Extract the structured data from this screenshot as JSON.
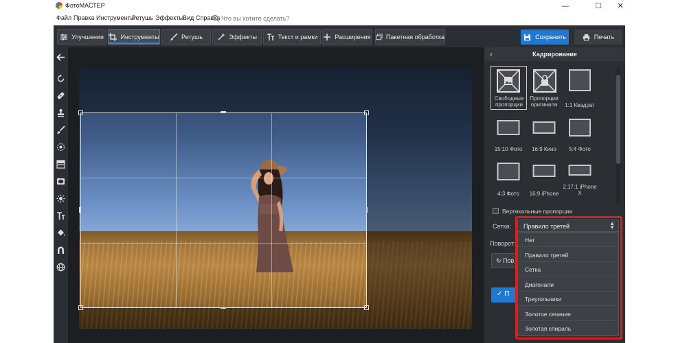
{
  "window": {
    "title": "ФотоМАСТЕР",
    "minimize": "—",
    "maximize": "☐",
    "close": "✕"
  },
  "menu": {
    "items": [
      "Файл",
      "Правка",
      "Инструменты",
      "Ретушь",
      "Эффекты",
      "Вид",
      "Справка"
    ],
    "search_placeholder": "Что вы хотите сделать?"
  },
  "toolbar": {
    "tabs": [
      {
        "label": "Улучшения",
        "icon": "sliders-icon"
      },
      {
        "label": "Инструменты",
        "icon": "crop-icon",
        "active": true
      },
      {
        "label": "Ретушь",
        "icon": "brush-icon"
      },
      {
        "label": "Эффекты",
        "icon": "magic-wand-icon"
      },
      {
        "label": "Текст и рамки",
        "icon": "text-icon"
      },
      {
        "label": "Расширения",
        "icon": "plus-icon"
      },
      {
        "label": "Пакетная обработка",
        "icon": "batch-icon"
      }
    ],
    "save_label": "Сохранить",
    "print_label": "Печать"
  },
  "left_tools": [
    "back-arrow-icon",
    "rotate-icon",
    "healing-patch-icon",
    "stamp-icon",
    "brush-icon",
    "radial-filter-icon",
    "gradient-filter-icon",
    "vignette-icon",
    "sun-icon",
    "text-icon",
    "fill-bucket-icon",
    "magnet-icon",
    "globe-icon"
  ],
  "panel": {
    "title": "Кадрирование",
    "presets": [
      {
        "label": "Свободные пропорции",
        "selected": true
      },
      {
        "label": "Пропорции оригинала"
      },
      {
        "label": "1:1 Квадрат"
      },
      {
        "label": "15:10 Фото"
      },
      {
        "label": "16:9 Кино"
      },
      {
        "label": "5:4 Фото"
      },
      {
        "label": "4:3 Фото"
      },
      {
        "label": "16:9 iPhone"
      },
      {
        "label": "2.17:1 iPhone X"
      }
    ],
    "vertical_label": "Вертикальные пропорции",
    "vertical_checked": false,
    "grid_label": "Сетка:",
    "grid_value": "Правило третей",
    "rotation_label": "Поворот:",
    "grid_options": [
      "Нет",
      "Правило третей",
      "Сетка",
      "Диагонали",
      "Треугольники",
      "Золотое сечение",
      "Золотая спираль"
    ],
    "button1_label": "Пов",
    "button2_label": "✓ П"
  },
  "colors": {
    "accent_blue": "#1f78d1",
    "highlight_red": "#d9201f",
    "panel_dark": "#2b2e32"
  }
}
